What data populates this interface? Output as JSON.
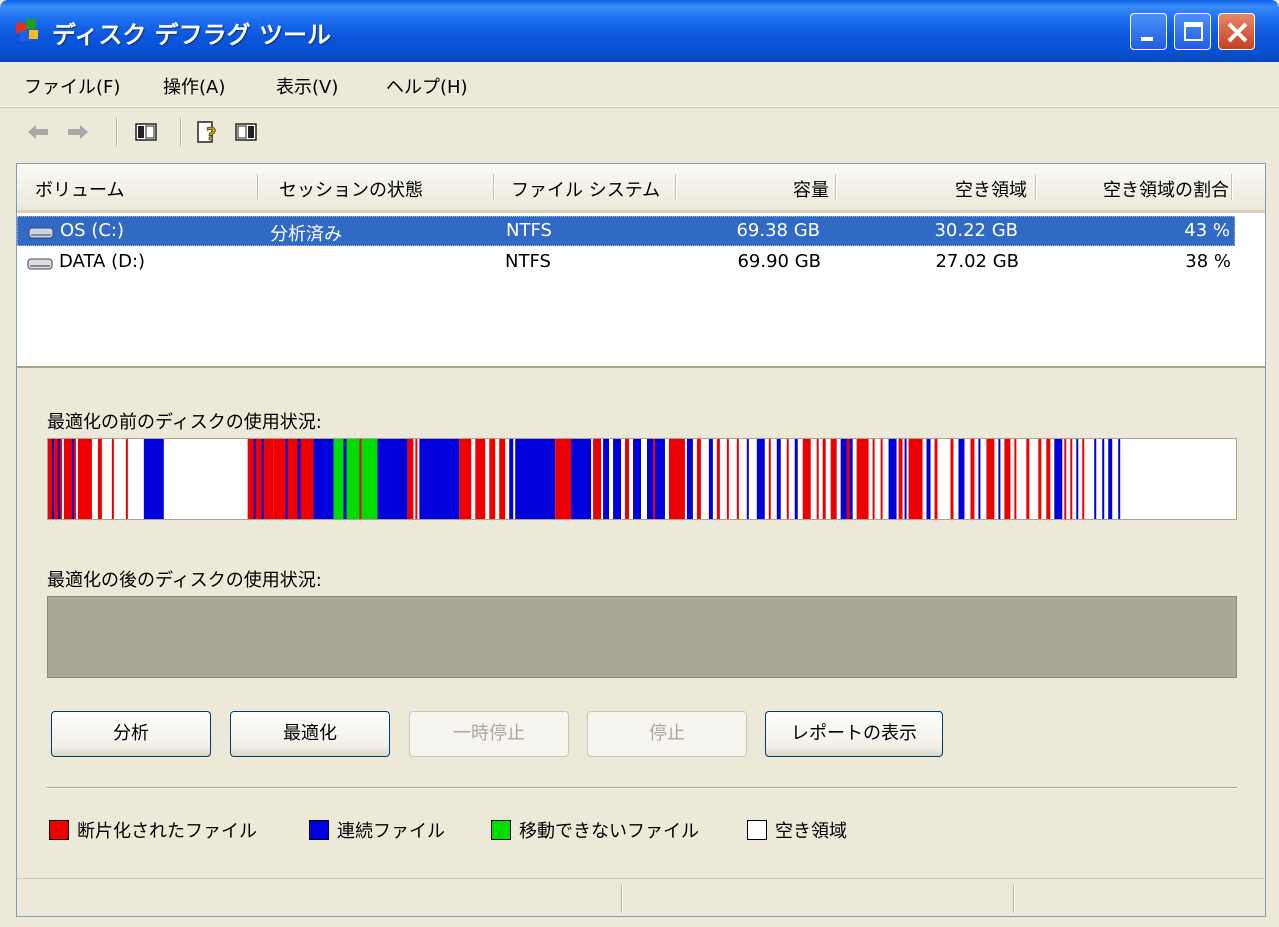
{
  "window": {
    "title": "ディスク デフラグ ツール"
  },
  "menu": [
    {
      "label": "ファイル(F)"
    },
    {
      "label": "操作(A)"
    },
    {
      "label": "表示(V)"
    },
    {
      "label": "ヘルプ(H)"
    }
  ],
  "volumes": {
    "columns": [
      "ボリューム",
      "セッションの状態",
      "ファイル システム",
      "容量",
      "空き領域",
      "空き領域の割合"
    ],
    "rows": [
      {
        "volume": "OS (C:)",
        "status": "分析済み",
        "fs": "NTFS",
        "capacity": "69.38 GB",
        "free": "30.22 GB",
        "free_pct": "43 %",
        "selected": true
      },
      {
        "volume": "DATA (D:)",
        "status": "",
        "fs": "NTFS",
        "capacity": "69.90 GB",
        "free": "27.02 GB",
        "free_pct": "38 %",
        "selected": false
      }
    ]
  },
  "analysis": {
    "before_label": "最適化の前のディスクの使用状況:",
    "after_label": "最適化の後のディスクの使用状況:"
  },
  "buttons": {
    "analyze": "分析",
    "defragment": "最適化",
    "pause": "一時停止",
    "stop": "停止",
    "report": "レポートの表示"
  },
  "legend": {
    "fragmented": "断片化されたファイル",
    "contiguous": "連続ファイル",
    "unmovable": "移動できないファイル",
    "free": "空き領域"
  },
  "colors": {
    "fragmented": "#ee0000",
    "contiguous": "#0000dd",
    "unmovable": "#00dd00",
    "free": "#ffffff",
    "selection": "#316ac5"
  }
}
